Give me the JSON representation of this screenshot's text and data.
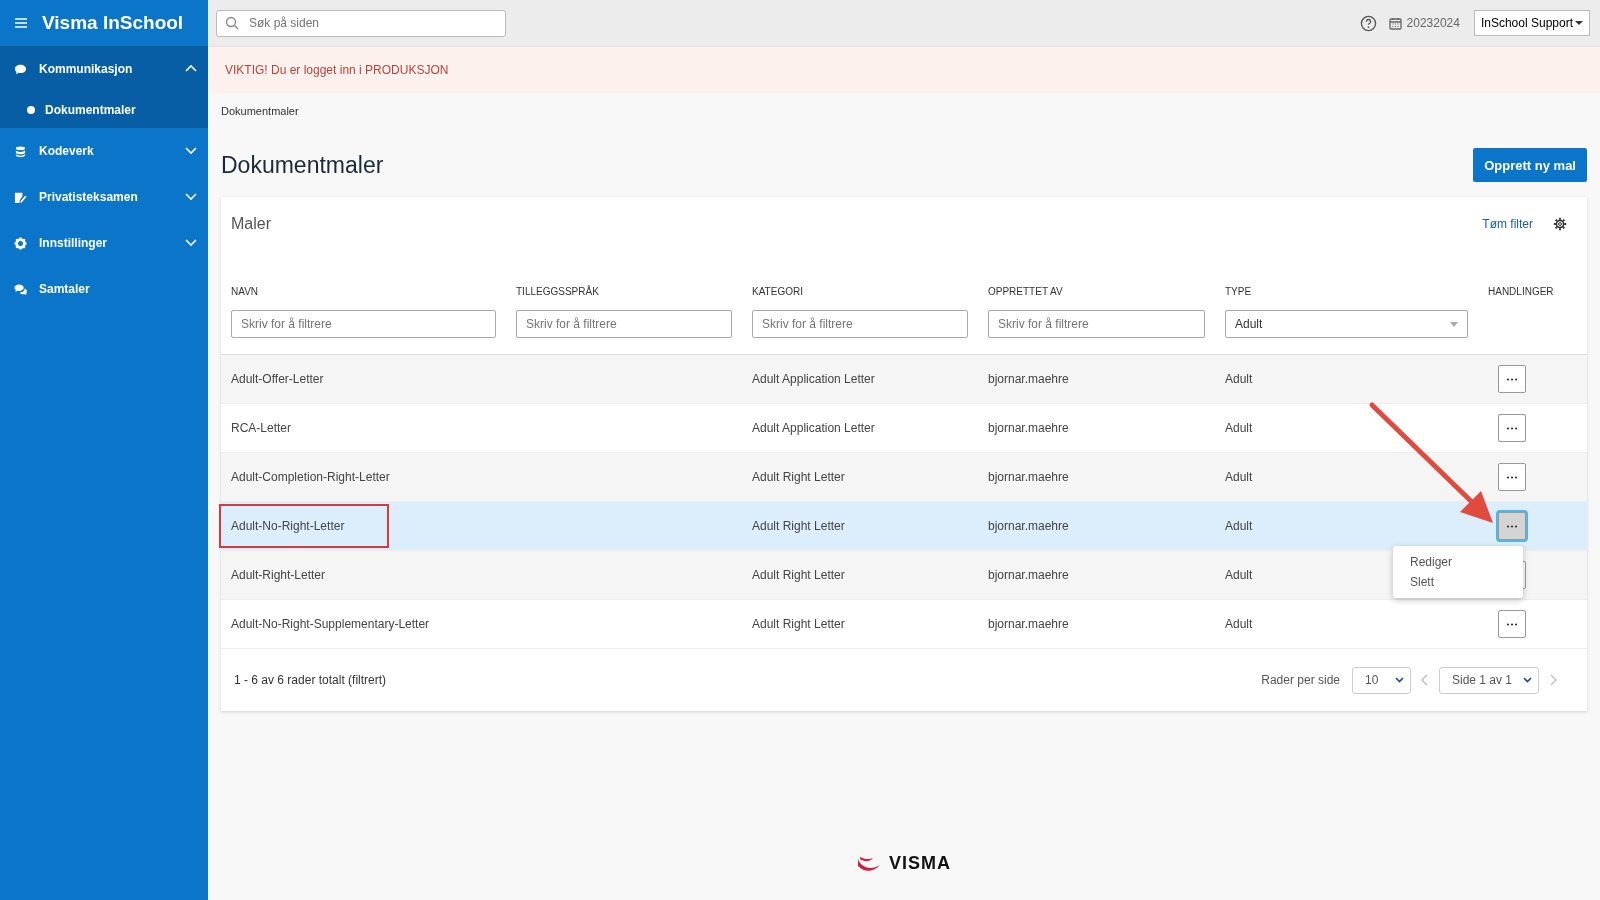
{
  "app": {
    "title": "Visma InSchool"
  },
  "sidebar": {
    "items": [
      {
        "label": "Kommunikasjon",
        "expanded": true,
        "children": [
          {
            "label": "Dokumentmaler",
            "selected": true
          }
        ]
      },
      {
        "label": "Kodeverk",
        "expanded": false
      },
      {
        "label": "Privatisteksamen",
        "expanded": false
      },
      {
        "label": "Innstillinger",
        "expanded": false
      },
      {
        "label": "Samtaler"
      }
    ]
  },
  "topbar": {
    "search": {
      "placeholder": "Søk på siden"
    },
    "school_year": "20232024",
    "user": "InSchool Support"
  },
  "banner": "VIKTIG! Du er logget inn i PRODUKSJON",
  "breadcrumb": "Dokumentmaler",
  "page_title": "Dokumentmaler",
  "create_button": "Opprett ny mal",
  "card": {
    "title": "Maler",
    "clear_filter": "Tøm filter",
    "columns": [
      {
        "label": "NAVN",
        "kind": "text",
        "placeholder": "Skriv for å filtrere"
      },
      {
        "label": "TILLEGGSSPRÅK",
        "kind": "text",
        "placeholder": "Skriv for å filtrere"
      },
      {
        "label": "KATEGORI",
        "kind": "text",
        "placeholder": "Skriv for å filtrere"
      },
      {
        "label": "OPPRETTET AV",
        "kind": "text",
        "placeholder": "Skriv for å filtrere"
      },
      {
        "label": "TYPE",
        "kind": "select",
        "value": "Adult"
      },
      {
        "label": "HANDLINGER",
        "kind": "actions"
      }
    ],
    "rows": [
      {
        "cells": [
          "Adult-Offer-Letter",
          "",
          "Adult Application Letter",
          "bjornar.maehre",
          "Adult"
        ],
        "selected": false,
        "highlighted": false
      },
      {
        "cells": [
          "RCA-Letter",
          "",
          "Adult Application Letter",
          "bjornar.maehre",
          "Adult"
        ],
        "selected": false,
        "highlighted": false
      },
      {
        "cells": [
          "Adult-Completion-Right-Letter",
          "",
          "Adult Right Letter",
          "bjornar.maehre",
          "Adult"
        ],
        "selected": false,
        "highlighted": false
      },
      {
        "cells": [
          "Adult-No-Right-Letter",
          "",
          "Adult Right Letter",
          "bjornar.maehre",
          "Adult"
        ],
        "selected": true,
        "highlighted": true,
        "menu": [
          "Rediger",
          "Slett"
        ]
      },
      {
        "cells": [
          "Adult-Right-Letter",
          "",
          "Adult Right Letter",
          "bjornar.maehre",
          "Adult"
        ],
        "selected": false,
        "highlighted": false
      },
      {
        "cells": [
          "Adult-No-Right-Supplementary-Letter",
          "",
          "Adult Right Letter",
          "bjornar.maehre",
          "Adult"
        ],
        "selected": false,
        "highlighted": false
      }
    ],
    "summary": "1 - 6 av 6 rader totalt (filtrert)",
    "rows_per_page_label": "Rader per side",
    "rows_per_page": "10",
    "page": "Side 1 av 1"
  },
  "footer_logo": "VISMA"
}
